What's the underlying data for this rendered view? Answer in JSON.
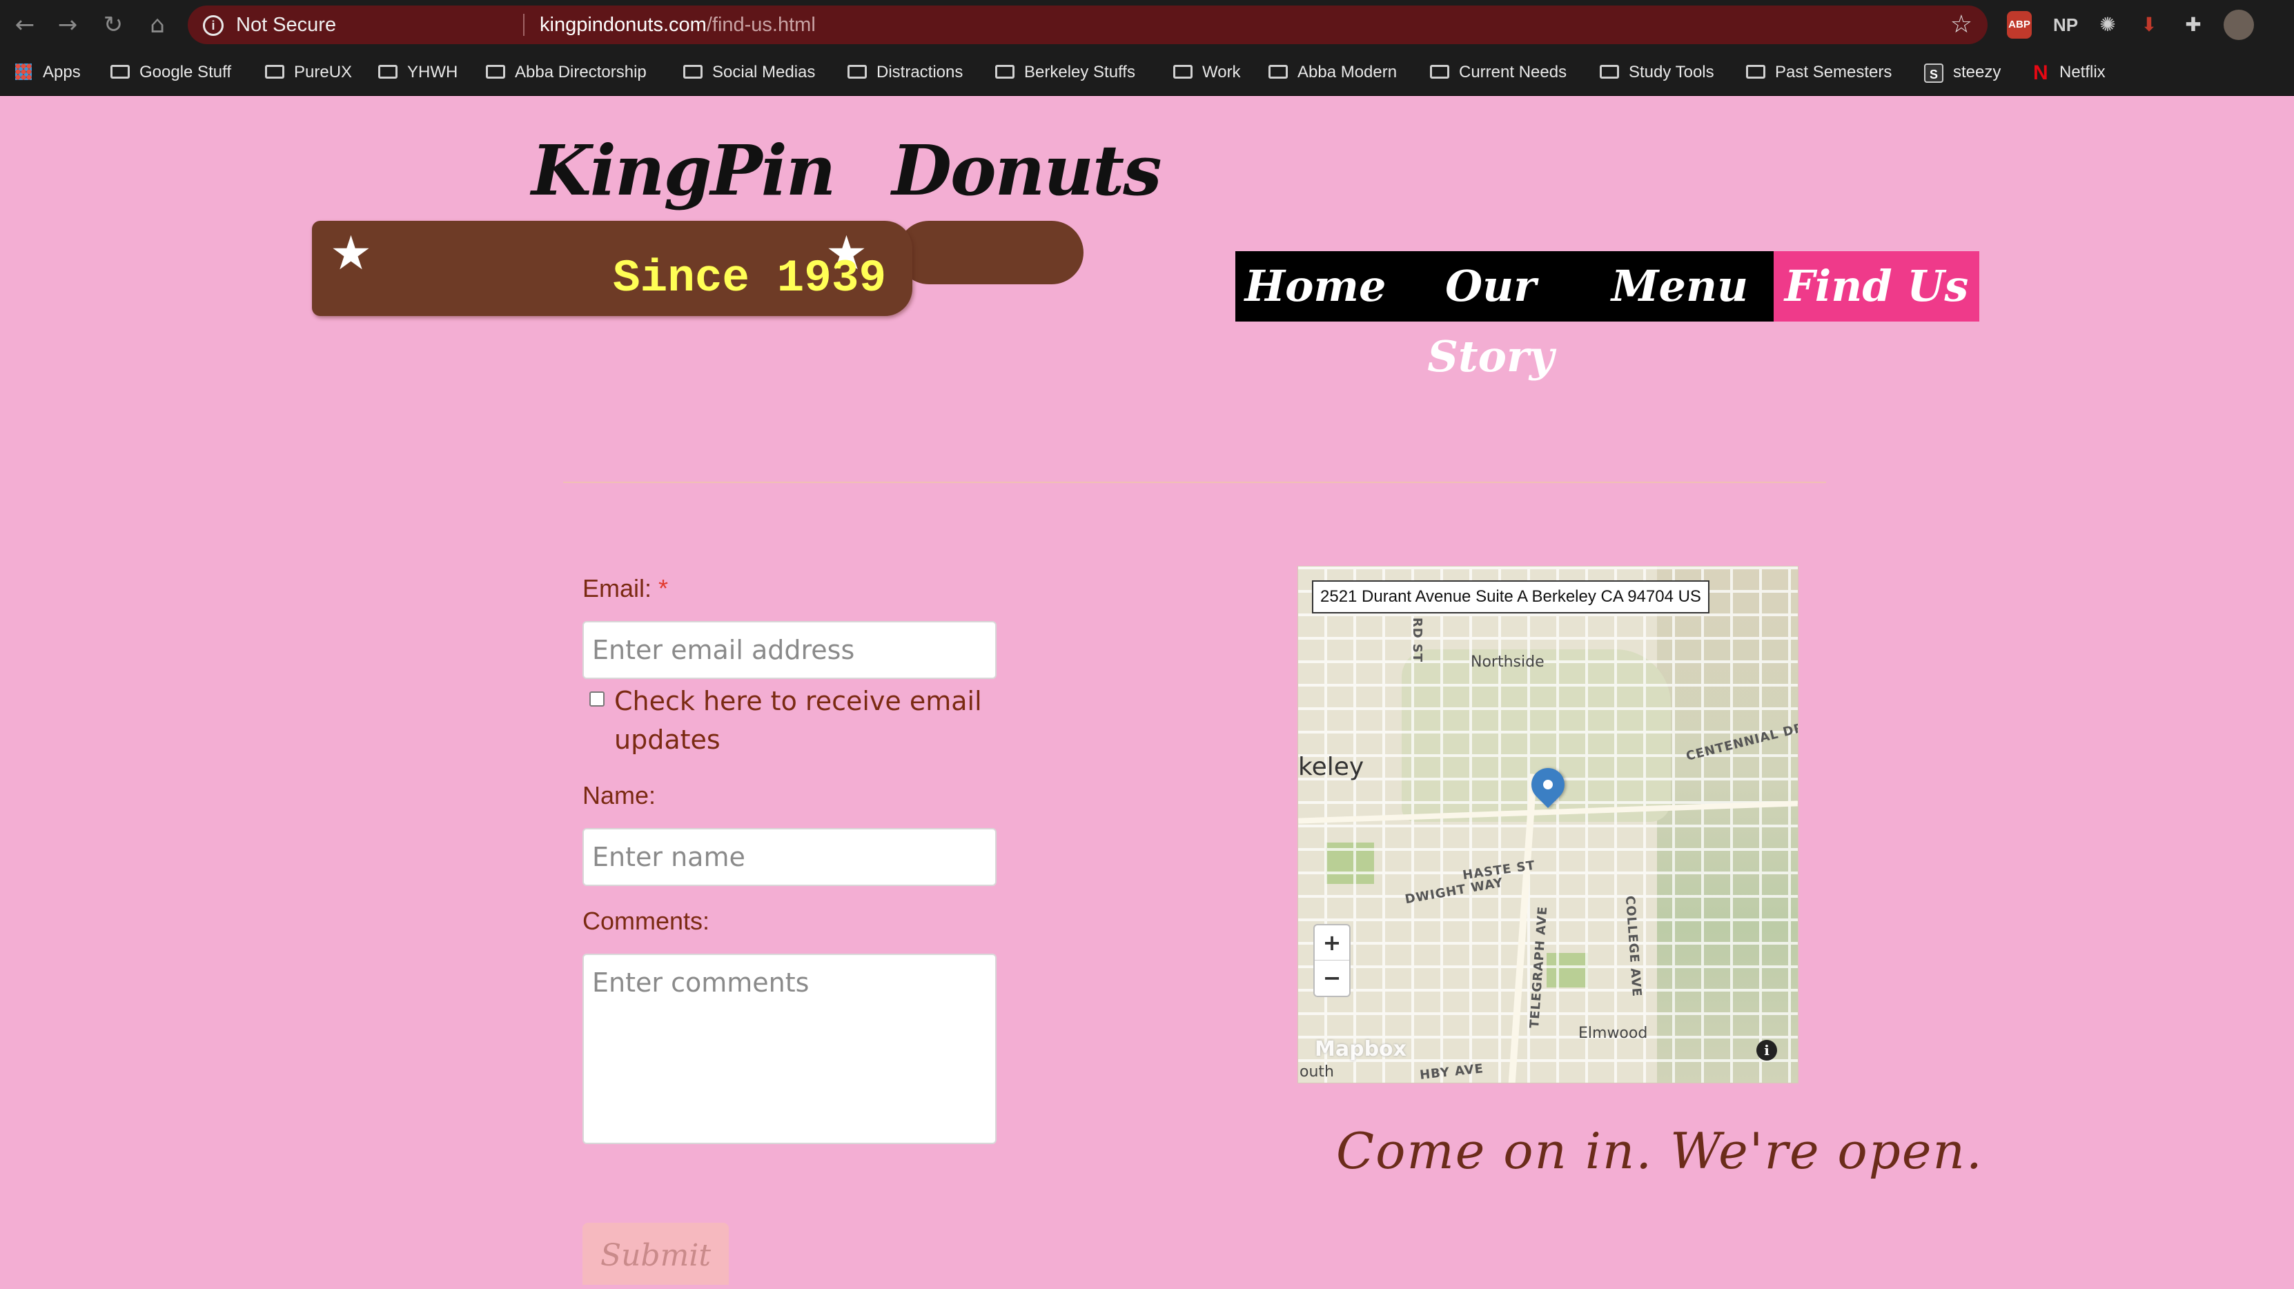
{
  "browser": {
    "security_label": "Not Secure",
    "url_domain": "kingpindonuts.com",
    "url_path": "/find-us.html",
    "extensions": {
      "abp_label": "ABP",
      "np_label": "NP"
    },
    "bookmarks": [
      {
        "label": "Apps",
        "icon": "apps-grid-icon"
      },
      {
        "label": "Google Stuff",
        "icon": "folder-icon"
      },
      {
        "label": "PureUX",
        "icon": "folder-icon"
      },
      {
        "label": "YHWH",
        "icon": "folder-icon"
      },
      {
        "label": "Abba Directorship",
        "icon": "folder-icon"
      },
      {
        "label": "Social Medias",
        "icon": "folder-icon"
      },
      {
        "label": "Distractions",
        "icon": "folder-icon"
      },
      {
        "label": "Berkeley Stuffs",
        "icon": "folder-icon"
      },
      {
        "label": "Work",
        "icon": "folder-icon"
      },
      {
        "label": "Abba Modern",
        "icon": "folder-icon"
      },
      {
        "label": "Current Needs",
        "icon": "folder-icon"
      },
      {
        "label": "Study Tools",
        "icon": "folder-icon"
      },
      {
        "label": "Past Semesters",
        "icon": "folder-icon"
      },
      {
        "label": "steezy",
        "icon": "steezy-icon",
        "icon_text": "S"
      },
      {
        "label": "Netflix",
        "icon": "netflix-icon",
        "icon_text": "N"
      }
    ]
  },
  "site": {
    "brand": "KingPin Donuts",
    "tagline": "Since 1939",
    "colors": {
      "background": "#f3aed3",
      "accent": "#ef3a8a",
      "board": "#6e3b26",
      "text": "#7a2a12"
    },
    "nav": [
      {
        "label": "Home",
        "active": false
      },
      {
        "label": "Our Story",
        "active": false
      },
      {
        "label": "Menu",
        "active": false
      },
      {
        "label": "Find Us",
        "active": true
      }
    ]
  },
  "form": {
    "email_label": "Email:",
    "email_required_mark": "*",
    "email_placeholder": "Enter email address",
    "updates_checkbox_label": "Check here to receive email updates",
    "updates_checked": false,
    "name_label": "Name:",
    "name_placeholder": "Enter name",
    "comments_label": "Comments:",
    "comments_placeholder": "Enter comments",
    "submit_label": "Submit"
  },
  "map": {
    "address": "2521 Durant Avenue Suite A Berkeley CA 94704 US",
    "labels": {
      "northside": "Northside",
      "berkeley": "keley",
      "centennial": "CENTENNIAL DR",
      "haste": "HASTE ST",
      "dwight": "DWIGHT WAY",
      "telegraph": "TELEGRAPH AVE",
      "college": "COLLEGE AVE",
      "elmwood": "Elmwood",
      "oxford": "RD ST",
      "south": "outh",
      "ashby": "HBY AVE"
    },
    "zoom_in": "+",
    "zoom_out": "−",
    "attribution": "Mapbox",
    "info": "i"
  },
  "status_message": "Come on in. We're open."
}
